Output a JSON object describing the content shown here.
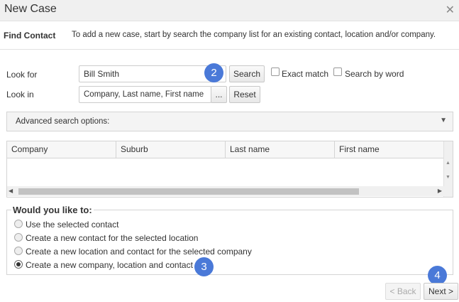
{
  "window": {
    "title": "New Case",
    "close_icon": "close-icon"
  },
  "find_contact": {
    "label": "Find Contact",
    "instructions": "To add a new case, start by search the company list for an existing contact, location and/or company."
  },
  "search": {
    "look_for_label": "Look for",
    "look_for_value": "Bill Smith",
    "search_button": "Search",
    "exact_match_label": "Exact match",
    "search_by_word_label": "Search by word",
    "look_in_label": "Look in",
    "look_in_value": "Company, Last name, First name",
    "browse_button": "...",
    "reset_button": "Reset"
  },
  "advanced": {
    "label": "Advanced search options:"
  },
  "results_grid": {
    "columns": [
      "Company",
      "Suburb",
      "Last name",
      "First name"
    ],
    "rows": []
  },
  "options": {
    "legend": "Would you like to:",
    "choices": [
      {
        "label": "Use the selected contact",
        "selected": false
      },
      {
        "label": "Create a new contact for the selected location",
        "selected": false
      },
      {
        "label": "Create a new location and contact for the selected company",
        "selected": false
      },
      {
        "label": "Create a new company, location and contact",
        "selected": true
      }
    ]
  },
  "footer": {
    "back_button": "< Back",
    "next_button": "Next >"
  },
  "step_badges": [
    "2",
    "3",
    "4"
  ],
  "colors": {
    "badge": "#4a79d8",
    "titlebar": "#f0f0f0"
  }
}
